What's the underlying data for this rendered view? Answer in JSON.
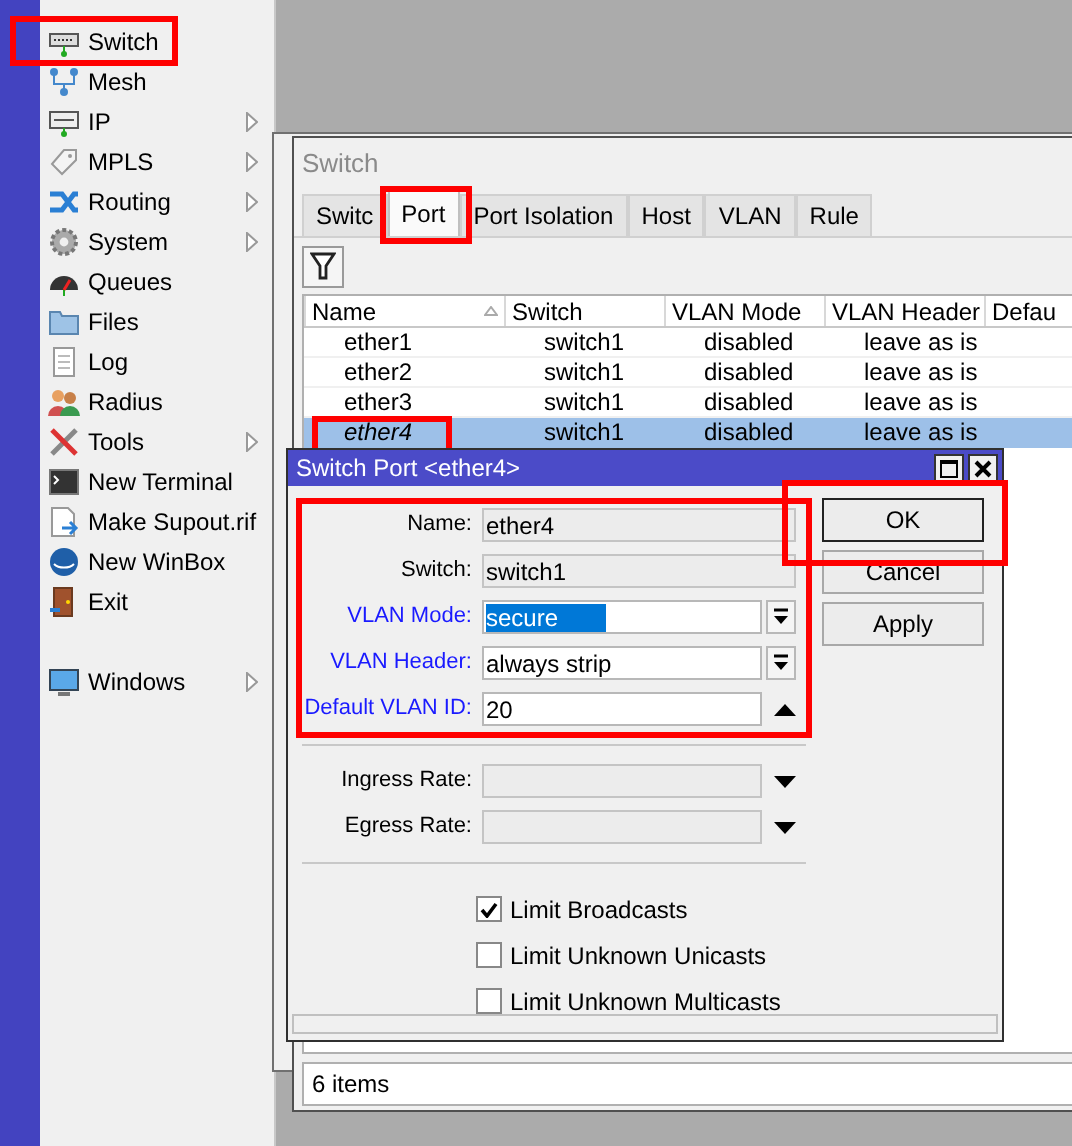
{
  "menu": {
    "items": [
      {
        "label": "Switch",
        "has_submenu": false
      },
      {
        "label": "Mesh",
        "has_submenu": false
      },
      {
        "label": "IP",
        "has_submenu": true
      },
      {
        "label": "MPLS",
        "has_submenu": true
      },
      {
        "label": "Routing",
        "has_submenu": true
      },
      {
        "label": "System",
        "has_submenu": true
      },
      {
        "label": "Queues",
        "has_submenu": false
      },
      {
        "label": "Files",
        "has_submenu": false
      },
      {
        "label": "Log",
        "has_submenu": false
      },
      {
        "label": "Radius",
        "has_submenu": false
      },
      {
        "label": "Tools",
        "has_submenu": true
      },
      {
        "label": "New Terminal",
        "has_submenu": false
      },
      {
        "label": "Make Supout.rif",
        "has_submenu": false
      },
      {
        "label": "New WinBox",
        "has_submenu": false
      },
      {
        "label": "Exit",
        "has_submenu": false
      },
      {
        "label": "Windows",
        "has_submenu": true
      }
    ]
  },
  "switch_window": {
    "title": "Switch",
    "tabs": [
      {
        "label": "Switc",
        "selected": false
      },
      {
        "label": "Port",
        "selected": true
      },
      {
        "label": "Port Isolation",
        "selected": false
      },
      {
        "label": "Host",
        "selected": false
      },
      {
        "label": "VLAN",
        "selected": false
      },
      {
        "label": "Rule",
        "selected": false
      }
    ],
    "table": {
      "columns": [
        {
          "label": "Name",
          "sorted": true
        },
        {
          "label": "Switch",
          "sorted": false
        },
        {
          "label": "VLAN Mode",
          "sorted": false
        },
        {
          "label": "VLAN Header",
          "sorted": false
        },
        {
          "label": "Defau",
          "sorted": false
        }
      ],
      "rows": [
        {
          "cells": [
            "ether1",
            "switch1",
            "disabled",
            "leave as is"
          ],
          "selected": false
        },
        {
          "cells": [
            "ether2",
            "switch1",
            "disabled",
            "leave as is"
          ],
          "selected": false
        },
        {
          "cells": [
            "ether3",
            "switch1",
            "disabled",
            "leave as is"
          ],
          "selected": false
        },
        {
          "cells": [
            "ether4",
            "switch1",
            "disabled",
            "leave as is"
          ],
          "selected": true
        }
      ]
    },
    "status": "6 items"
  },
  "dialog": {
    "title": "Switch Port <ether4>",
    "fields": [
      {
        "kind": "text",
        "label": "Name:",
        "value": "ether4",
        "editable": false,
        "changed": false
      },
      {
        "kind": "text",
        "label": "Switch:",
        "value": "switch1",
        "editable": false,
        "changed": false
      },
      {
        "kind": "select",
        "label": "VLAN Mode:",
        "value": "secure",
        "editable": true,
        "changed": true,
        "focused": true
      },
      {
        "kind": "select",
        "label": "VLAN Header:",
        "value": "always strip",
        "editable": true,
        "changed": true,
        "focused": false
      },
      {
        "kind": "spin",
        "label": "Default VLAN ID:",
        "value": "20",
        "editable": true,
        "changed": true
      },
      {
        "kind": "separator"
      },
      {
        "kind": "optional",
        "label": "Ingress Rate:",
        "editable": false,
        "changed": false
      },
      {
        "kind": "optional",
        "label": "Egress Rate:",
        "editable": false,
        "changed": false
      },
      {
        "kind": "separator"
      }
    ],
    "checkboxes": [
      {
        "label": "Limit Broadcasts",
        "checked": true
      },
      {
        "label": "Limit Unknown Unicasts",
        "checked": false
      },
      {
        "label": "Limit Unknown Multicasts",
        "checked": false
      }
    ],
    "buttons": [
      "OK",
      "Cancel",
      "Apply"
    ]
  }
}
